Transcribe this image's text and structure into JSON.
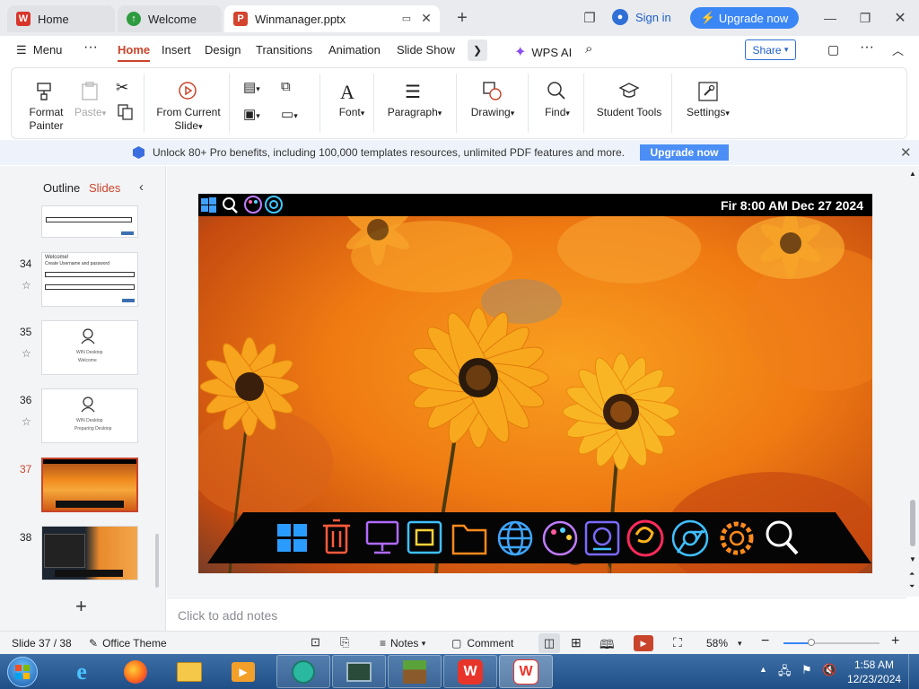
{
  "tabs": [
    {
      "label": "Home"
    },
    {
      "label": "Welcome"
    },
    {
      "label": "Winmanager.pptx"
    }
  ],
  "titlebar": {
    "sign_in": "Sign in",
    "upgrade": "Upgrade now"
  },
  "menu": {
    "menu": "Menu",
    "items": [
      "Home",
      "Insert",
      "Design",
      "Transitions",
      "Animation",
      "Slide Show"
    ],
    "wps_ai": "WPS AI",
    "share": "Share"
  },
  "ribbon": {
    "format_painter": "Format\nPainter",
    "paste": "Paste",
    "from_current": "From Current",
    "slide": "Slide",
    "font": "Font",
    "paragraph": "Paragraph",
    "drawing": "Drawing",
    "find": "Find",
    "student_tools": "Student Tools",
    "settings": "Settings"
  },
  "banner": {
    "text": "Unlock 80+ Pro benefits, including 100,000 templates resources, unlimited PDF features and more.",
    "button": "Upgrade now"
  },
  "leftpanel": {
    "outline": "Outline",
    "slides": "Slides",
    "numbers": [
      "34",
      "35",
      "36",
      "37",
      "38"
    ],
    "thumb34": {
      "title": "Welcome!",
      "subtitle": "Create Username and password"
    },
    "thumb35": {
      "name": "WIN Desktop",
      "status": "Welcome"
    },
    "thumb36": {
      "name": "WIN Desktop",
      "status": "Preparing Desktop"
    }
  },
  "slide": {
    "datetime": "Fir 8:00 AM Dec 27 2024"
  },
  "notes": {
    "placeholder": "Click to add notes"
  },
  "status": {
    "slide": "Slide 37 / 38",
    "theme": "Office Theme",
    "notes": "Notes",
    "comment": "Comment",
    "zoom": "58%",
    "zoom_level": 0.58
  },
  "taskbar": {
    "time": "1:58 AM",
    "date": "12/23/2024"
  },
  "colors": {
    "accent": "#c8452c",
    "upgrade": "#3b86f5",
    "taskbar": "#2a5a92"
  }
}
